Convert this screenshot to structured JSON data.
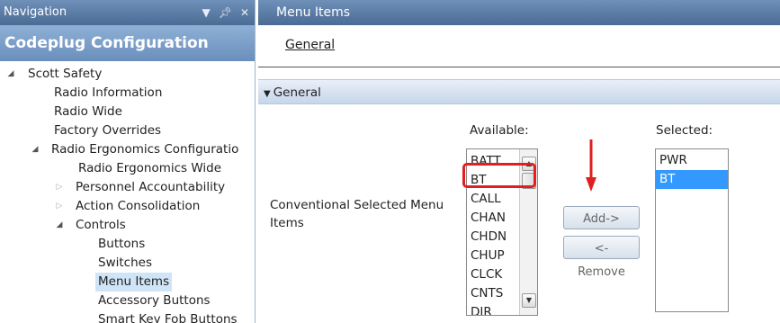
{
  "navigation": {
    "title": "Navigation",
    "title_icons": [
      "pin-icon",
      "close-icon"
    ],
    "header": "Codeplug Configuration",
    "tree": [
      {
        "label": "Scott Safety",
        "toggle": "expanded"
      },
      {
        "label": "Radio Information",
        "toggle": "none"
      },
      {
        "label": "Radio Wide",
        "toggle": "none"
      },
      {
        "label": "Factory Overrides",
        "toggle": "none"
      },
      {
        "label": "Radio Ergonomics Configuratio",
        "toggle": "expanded"
      },
      {
        "label": "Radio Ergonomics Wide",
        "toggle": "none"
      },
      {
        "label": "Personnel Accountability",
        "toggle": "collapsed"
      },
      {
        "label": "Action Consolidation",
        "toggle": "collapsed"
      },
      {
        "label": "Controls",
        "toggle": "expanded"
      },
      {
        "label": "Buttons",
        "toggle": "none"
      },
      {
        "label": "Switches",
        "toggle": "none"
      },
      {
        "label": "Menu Items",
        "toggle": "none",
        "selected": true
      },
      {
        "label": "Accessory Buttons",
        "toggle": "none"
      },
      {
        "label": "Smart Key Fob Buttons",
        "toggle": "none"
      }
    ]
  },
  "main": {
    "title": "Menu Items",
    "tab": "General",
    "section": "General",
    "field_label": "Conventional Selected Menu Items",
    "available_label": "Available:",
    "selected_label": "Selected:",
    "available_items": [
      "BATT",
      "BT",
      "CALL",
      "CHAN",
      "CHDN",
      "CHUP",
      "CLCK",
      "CNTS",
      "DIR"
    ],
    "selected_items": [
      "PWR",
      "BT"
    ],
    "selected_items_highlight": "BT",
    "add_button": "Add->",
    "remove_button": "<- Remove"
  },
  "colors": {
    "titlebar": "#4a6b95",
    "header": "#6a8fbb",
    "selection": "#3399ff",
    "annotation": "#e02020"
  }
}
